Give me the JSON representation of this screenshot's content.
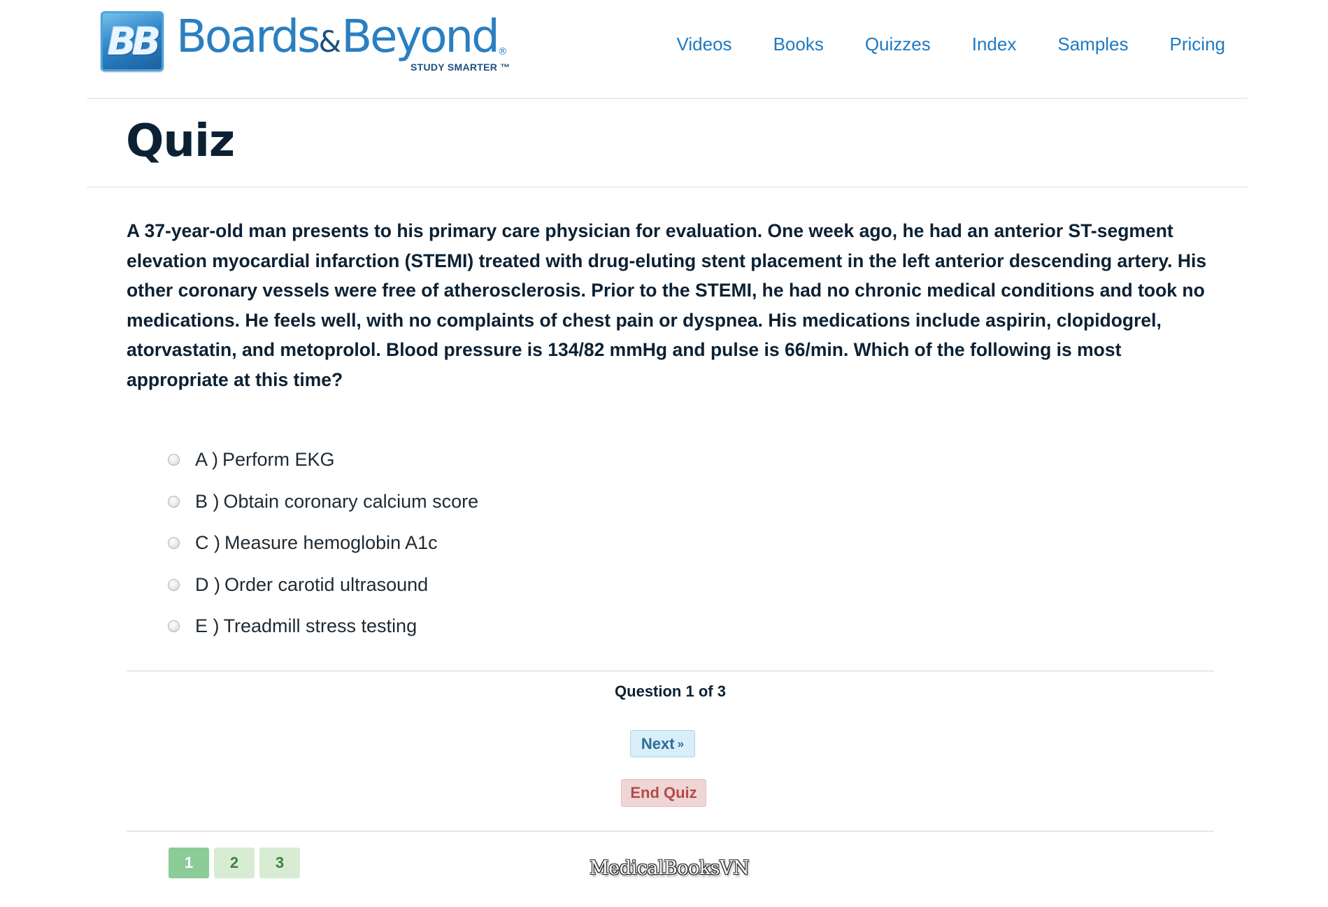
{
  "header": {
    "logo": {
      "badge_text": "BB",
      "word_left": "Boards",
      "word_amp": "&",
      "word_right": "Beyond",
      "registered": "®",
      "tagline": "STUDY SMARTER ™"
    },
    "nav": [
      {
        "label": "Videos"
      },
      {
        "label": "Books"
      },
      {
        "label": "Quizzes"
      },
      {
        "label": "Index"
      },
      {
        "label": "Samples"
      },
      {
        "label": "Pricing"
      }
    ]
  },
  "page": {
    "title": "Quiz"
  },
  "question": {
    "text": "A 37-year-old man presents to his primary care physician for evaluation. One week ago, he had an anterior ST-segment elevation myocardial infarction (STEMI) treated with drug-eluting stent placement in the left anterior descending artery. His other coronary vessels were free of atherosclerosis. Prior to the STEMI, he had no chronic medical conditions and took no medications. He feels well, with no complaints of chest pain or dyspnea. His medications include aspirin, clopidogrel, atorvastatin, and metoprolol. Blood pressure is 134/82 mmHg and pulse is 66/min. Which of the following is most appropriate at this time?",
    "options": [
      {
        "letter": "A )",
        "text": "Perform EKG"
      },
      {
        "letter": "B )",
        "text": "Obtain coronary calcium score"
      },
      {
        "letter": "C )",
        "text": "Measure hemoglobin A1c"
      },
      {
        "letter": "D )",
        "text": "Order carotid ultrasound"
      },
      {
        "letter": "E )",
        "text": "Treadmill stress testing"
      }
    ]
  },
  "controls": {
    "progress": "Question 1 of 3",
    "next_label": "Next",
    "next_chevron": "»",
    "end_label": "End Quiz"
  },
  "pager": {
    "pages": [
      "1",
      "2",
      "3"
    ],
    "current": "1"
  },
  "watermark": "MedicalBooksVN",
  "colors": {
    "brand_blue": "#1f7ac1",
    "title_navy": "#0c2133",
    "next_bg": "#d9eef9",
    "end_bg": "#f0d5d5",
    "end_text": "#b44b4b",
    "pager_current": "#8ccc98",
    "pager_other": "#d8ecd3"
  }
}
